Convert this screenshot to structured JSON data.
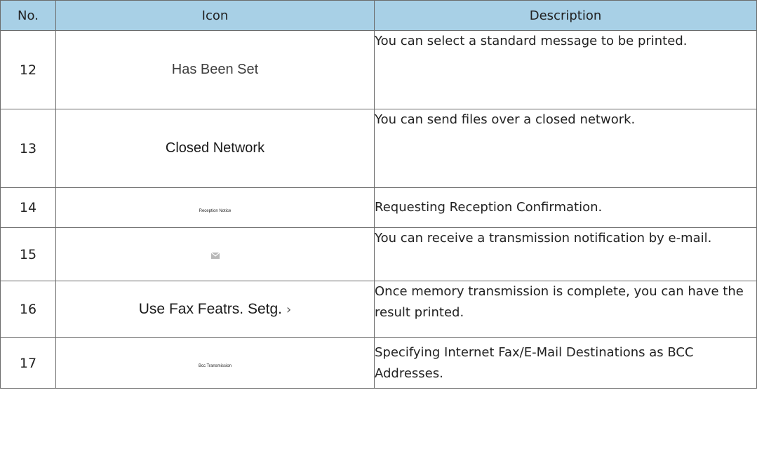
{
  "table": {
    "headers": {
      "no": "No.",
      "icon": "Icon",
      "description": "Description"
    },
    "rows": [
      {
        "no": "12",
        "icon_text": "Has Been Set",
        "description": "You can select a standard message to be printed."
      },
      {
        "no": "13",
        "icon_text": "Closed Network",
        "description": "You can send files over a closed network."
      },
      {
        "no": "14",
        "icon_text": "Reception Notice",
        "description": "Requesting Reception Confirmation."
      },
      {
        "no": "15",
        "icon": "envelope-icon",
        "description": "You can receive a transmission notification by e-mail."
      },
      {
        "no": "16",
        "icon_text": "Use Fax Featrs. Setg.",
        "icon_suffix": "chevron-right-icon",
        "description": "Once memory transmission is complete, you can have the result printed."
      },
      {
        "no": "17",
        "icon_text": "Bcc Transmission",
        "description": "Specifying Internet Fax/E-Mail Destinations as BCC Addresses."
      }
    ]
  },
  "colors": {
    "header_background": "#a8d0e6",
    "border": "#6b6b6b",
    "text": "#222222"
  }
}
